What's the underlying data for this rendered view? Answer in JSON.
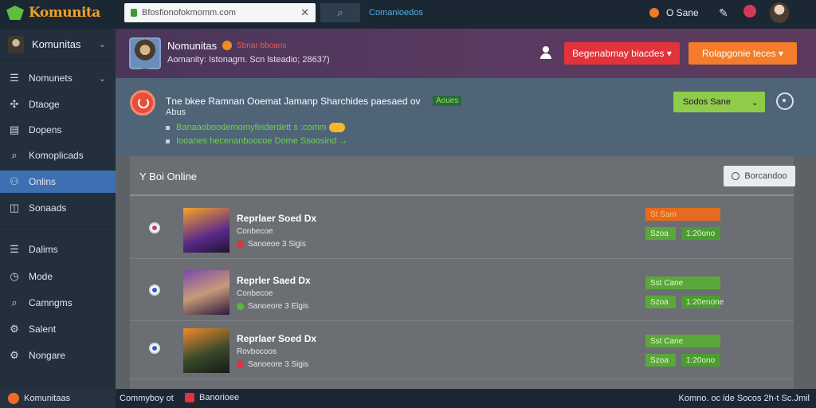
{
  "topbar": {
    "logo_text": "Komunita",
    "search_value": "Bfosfionofokmomm.com",
    "link": "Comanioedos",
    "status": "O Sane"
  },
  "sidebar": {
    "header": "Komunitas",
    "items": [
      {
        "icon": "list-icon",
        "label": "Nomunets"
      },
      {
        "icon": "puzzle-icon",
        "label": "Dtaoge"
      },
      {
        "icon": "document-icon",
        "label": "Dopens"
      },
      {
        "icon": "search-icon",
        "label": "Komoplicads"
      },
      {
        "icon": "users-icon",
        "label": "Onlins"
      },
      {
        "icon": "book-icon",
        "label": "Sonaads"
      },
      {
        "icon": "list-icon",
        "label": "Dalims"
      },
      {
        "icon": "clock-icon",
        "label": "Mode"
      },
      {
        "icon": "search-icon",
        "label": "Camngms"
      },
      {
        "icon": "gear-icon",
        "label": "Salent"
      },
      {
        "icon": "settings-icon",
        "label": "Nongare"
      }
    ],
    "active_index": 4
  },
  "banner": {
    "name": "Nomunitas",
    "tag": "Sbnar bboans",
    "subtitle": "Aomanity: Istonagm. Scn lsteadio; 28637)",
    "btn_red": "Begenabmay biacdes",
    "btn_orange": "Rolapgonie teces"
  },
  "notice": {
    "title": "Tne bkee Ramnan Ooemat Jamanp Sharchides paesaed ov",
    "tag": "Aoues",
    "subtitle": "Abus",
    "line1": "Banaaoboodemomyfeiderdett s :comm",
    "line2": "Iooanes hecenanboocoe Dome Ssoosind",
    "select": "Sodos Sane"
  },
  "list": {
    "title": "Y Boi Online",
    "action": "Borcandoo",
    "rows": [
      {
        "name": "Reprlaer Soed Dx",
        "sub": "Conbecoe",
        "meta": "Sanoeoe 3 Sigis",
        "badge1": "St Sam",
        "badge2": "Szoa",
        "badge3": "1:20ono",
        "badge1_color": "orange"
      },
      {
        "name": "Reprler Saed Dx",
        "sub": "Conbecoe",
        "meta": "Sanoeore 3 Elgis",
        "badge1": "Sst Cane",
        "badge2": "Szoa",
        "badge3": "1:20enone",
        "badge1_color": "green"
      },
      {
        "name": "Reprlaer Soed Dx",
        "sub": "Rovbocoos",
        "meta": "Sanoeore 3 Sigis",
        "badge1": "Sst Cane",
        "badge2": "Szoa",
        "badge3": "1:20ono",
        "badge1_color": "green"
      }
    ]
  },
  "bottombar": {
    "left": "Komunitaas",
    "mid": "Commyboy ot",
    "mid2": "Banorioee",
    "right": "Komno. oc ide Socos 2h-t Sc.Jmil"
  },
  "colors": {
    "accent_blue": "#3e6fb3",
    "red": "#e2323a",
    "orange": "#f47c2a",
    "green": "#8fcc4a"
  }
}
